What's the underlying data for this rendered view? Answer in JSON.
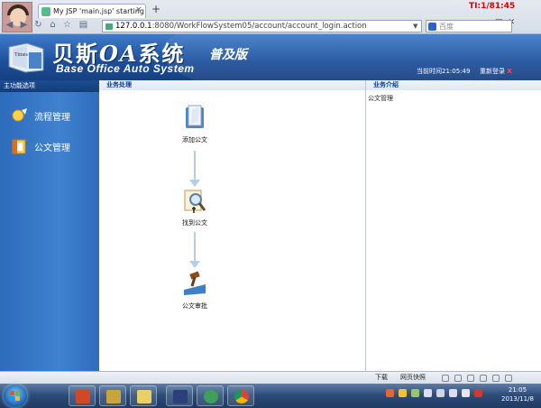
{
  "browser": {
    "tab_title": "My JSP 'main.jsp' starting",
    "tab_close": "×",
    "new_tab": "+",
    "clock_overlay": "TI:1/81:45",
    "url_host": "127.0.0.1",
    "url_rest": ":8080/WorkFlowSystem05/account/account_login.action",
    "search_placeholder": "百度",
    "nav_icons": [
      "back-icon",
      "forward-icon",
      "reload-icon",
      "home-icon",
      "star-icon",
      "bookmark-icon"
    ]
  },
  "header": {
    "title_cn_1": "贝斯",
    "title_cn_oa": "OA",
    "title_cn_2": "系统",
    "edition": "普及版",
    "title_en": "Base Office Auto System",
    "now_time": "当前时间21:05:49",
    "relogin": "重新登录",
    "relogin_x": "X"
  },
  "sidebar": {
    "heading": "主功能选项",
    "items": [
      {
        "label": "流程管理",
        "icon": "process-icon"
      },
      {
        "label": "公文管理",
        "icon": "document-icon"
      }
    ]
  },
  "main": {
    "heading": "业务处理",
    "nodes": [
      {
        "label": "添加公文",
        "icon": "add-document-icon"
      },
      {
        "label": "找到公文",
        "icon": "search-document-icon"
      },
      {
        "label": "公文审批",
        "icon": "approve-document-icon"
      }
    ]
  },
  "right": {
    "heading": "业务介绍",
    "link": "公文管理"
  },
  "status": {
    "download": "下载",
    "snapshot": "网页快照"
  },
  "taskbar": {
    "time": "21:05",
    "date": "2013/11/8",
    "apps": [
      "powerpoint-icon",
      "game-icon",
      "explorer-icon",
      "eclipse-icon",
      "globe-icon",
      "chrome-icon"
    ]
  },
  "colors": {
    "header_blue": "#1d4f9a",
    "sidebar_blue": "#3f82d0",
    "arrow": "#b6cde8",
    "warning_red": "#ff5050"
  }
}
